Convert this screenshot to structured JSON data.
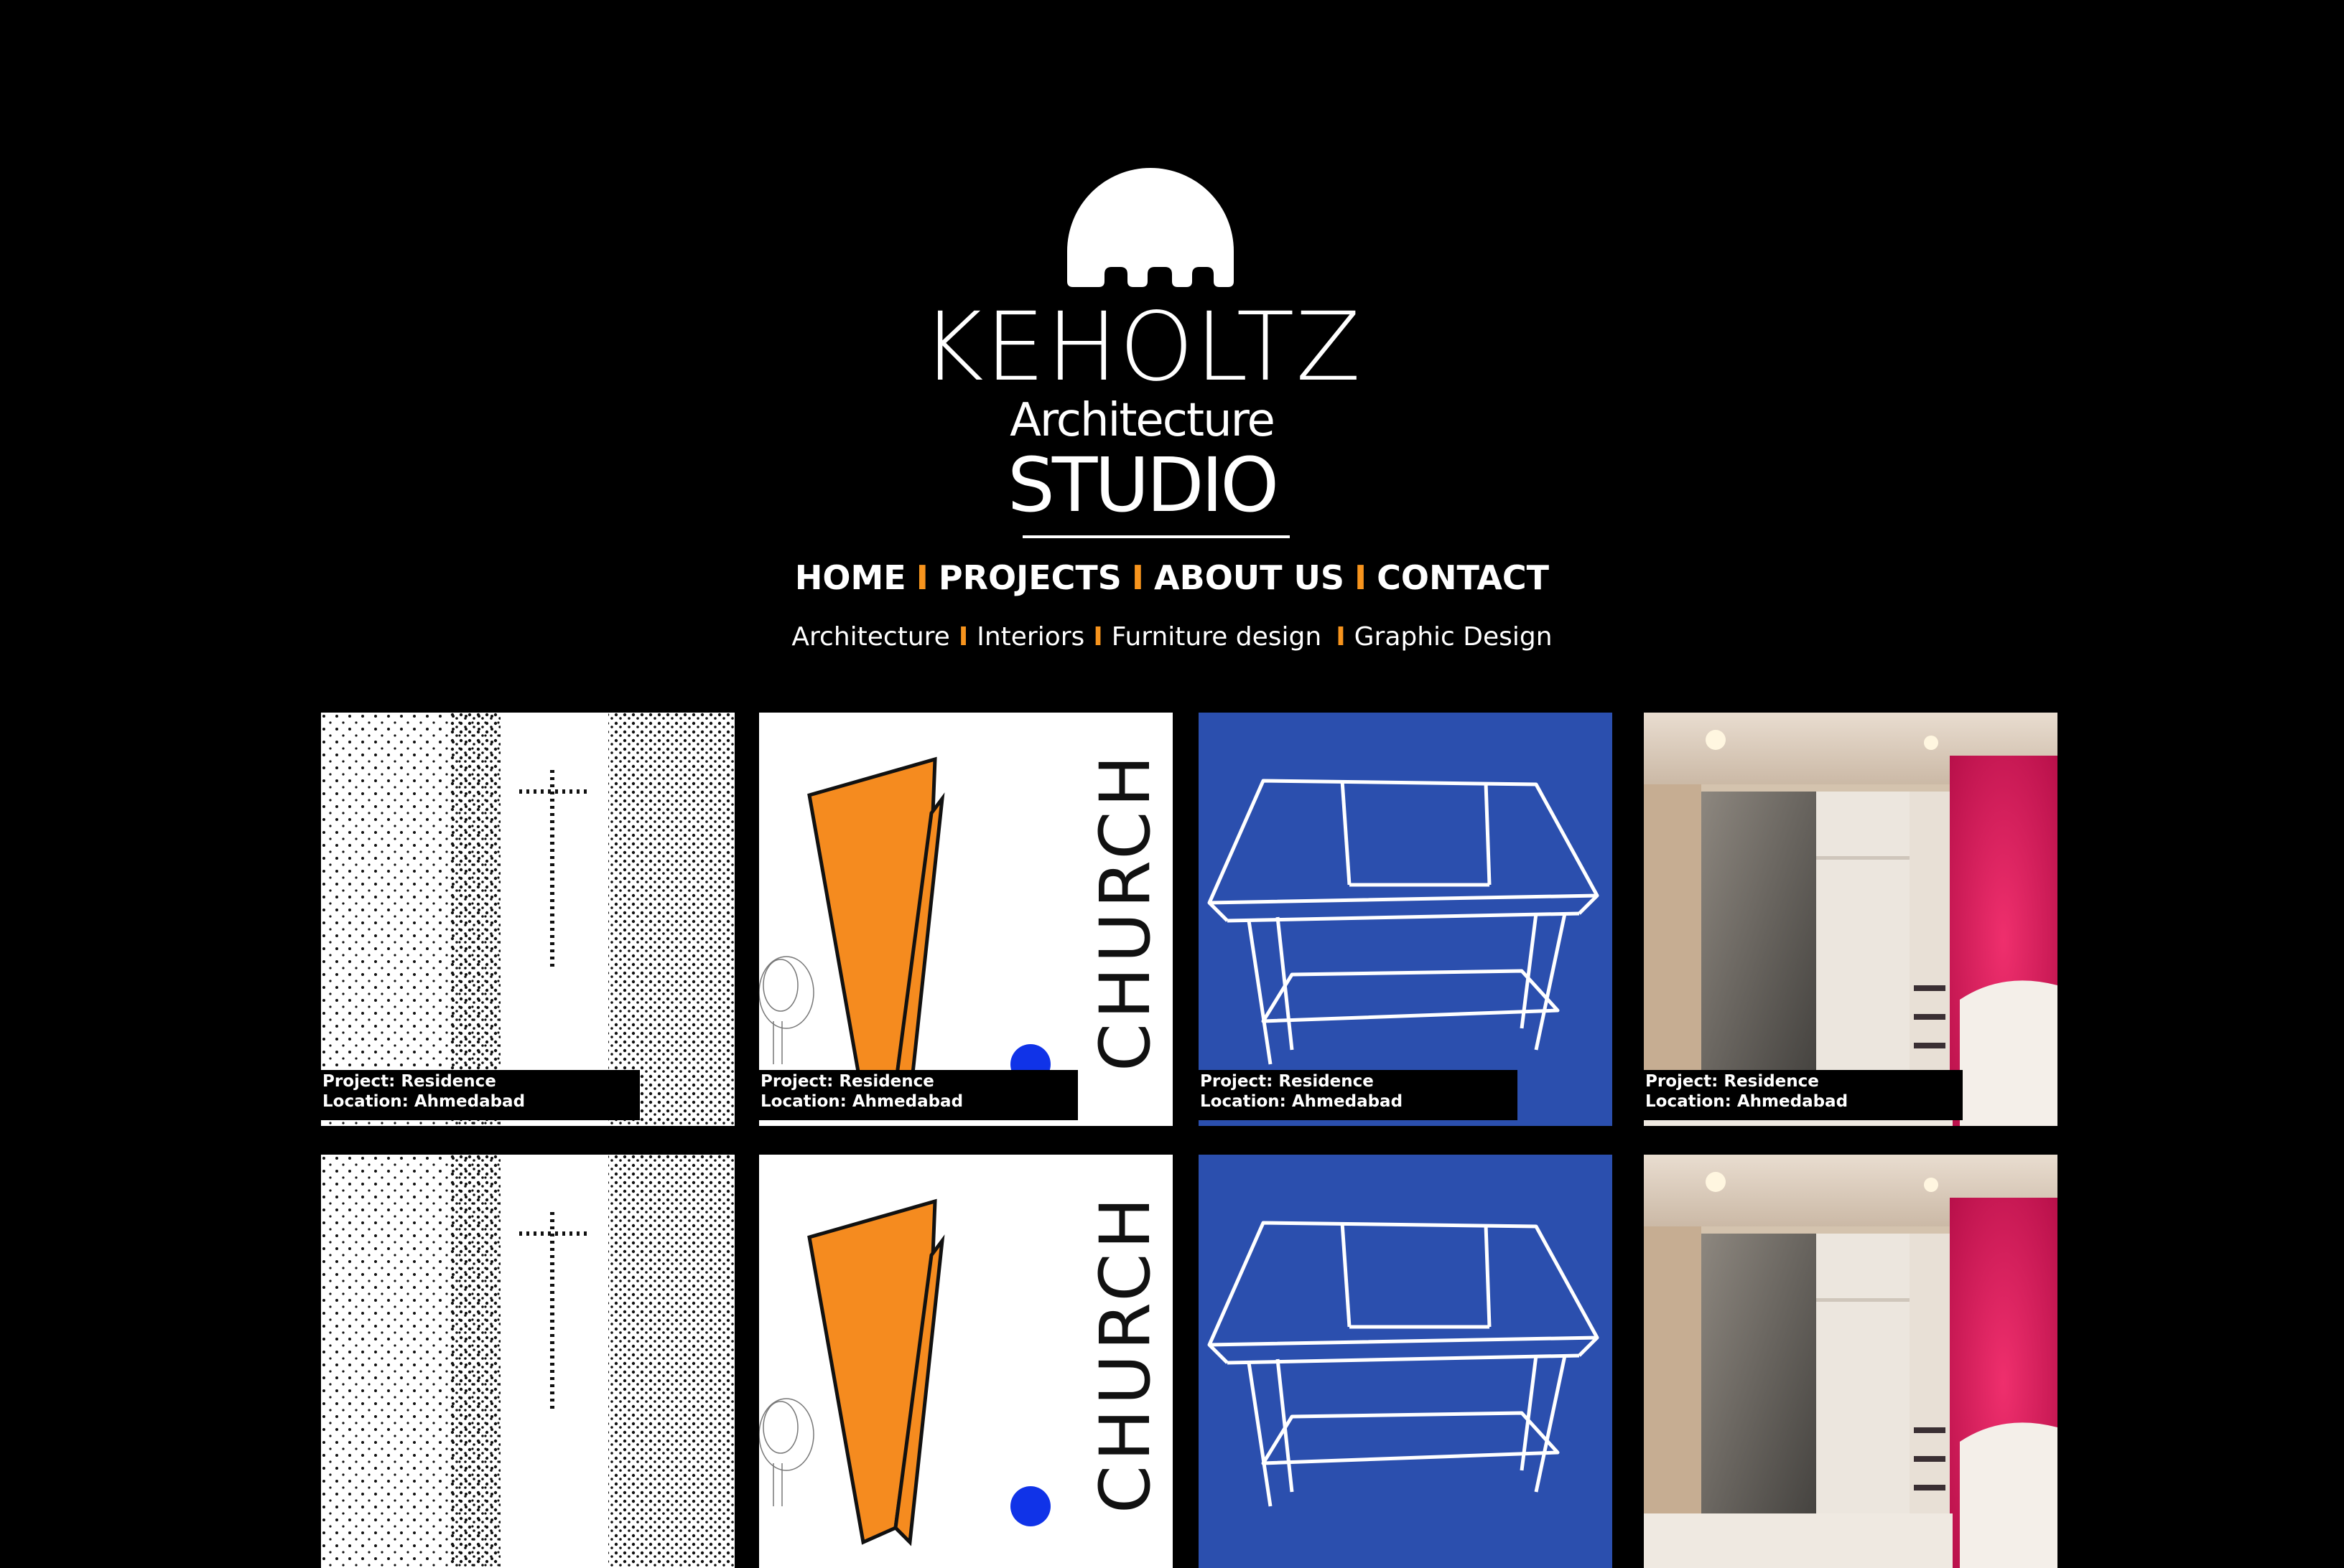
{
  "brand": {
    "name": "KEHOLTZ",
    "subtitle": "Architecture",
    "studio": "STUDIO"
  },
  "main_nav": {
    "items": [
      {
        "label": "HOME"
      },
      {
        "label": "PROJECTS"
      },
      {
        "label": "ABOUT US"
      },
      {
        "label": "CONTACT"
      }
    ],
    "separator": "I"
  },
  "sub_nav": {
    "items": [
      {
        "label": "Architecture"
      },
      {
        "label": "Interiors"
      },
      {
        "label": "Furniture design"
      },
      {
        "label": "Graphic Design"
      }
    ],
    "separator": "I"
  },
  "tiles": [
    {
      "project": "Project: Residence",
      "location": "Location: Ahmedabad",
      "image": "dotted-cross-drawing"
    },
    {
      "project": "Project: Residence",
      "location": "Location: Ahmedabad",
      "image": "church-poster",
      "poster_text": "CHURCH"
    },
    {
      "project": "Project: Residence",
      "location": "Location: Ahmedabad",
      "image": "table-sketch-blue"
    },
    {
      "project": "Project: Residence",
      "location": "Location: Ahmedabad",
      "image": "bedroom-wardrobe-photo"
    },
    {
      "project": "",
      "location": "",
      "image": "dotted-cross-drawing"
    },
    {
      "project": "",
      "location": "",
      "image": "church-poster",
      "poster_text": "CHURCH"
    },
    {
      "project": "",
      "location": "",
      "image": "table-sketch-blue"
    },
    {
      "project": "",
      "location": "",
      "image": "bedroom-wardrobe-photo"
    }
  ],
  "colors": {
    "background": "#000000",
    "accent": "#f7941d",
    "text": "#ffffff",
    "blue_tile": "#2b4fae",
    "orange_shape": "#f58b1f",
    "pink_wall": "#e2195a"
  }
}
